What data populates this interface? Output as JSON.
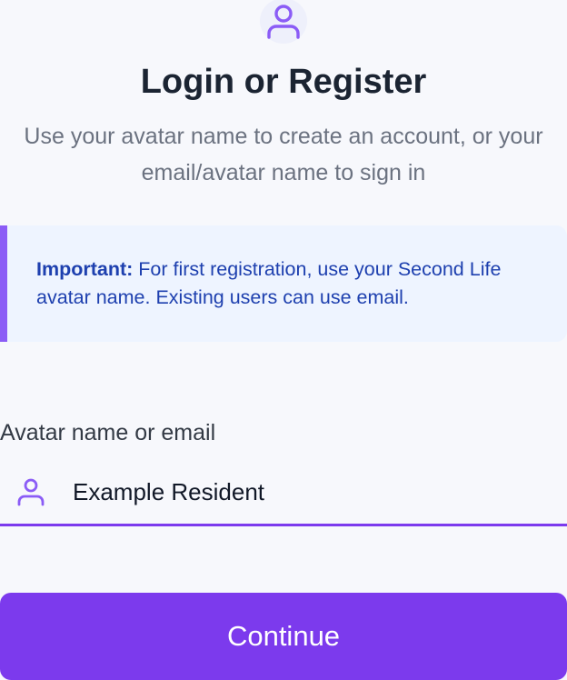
{
  "header": {
    "icon": "user-icon",
    "title": "Login or Register",
    "subtitle": "Use your avatar name to create an account, or your email/avatar name to sign in"
  },
  "notice": {
    "label": "Important:",
    "text": " For first registration, use your Second Life avatar name. Existing users can use email."
  },
  "form": {
    "field_label": "Avatar name or email",
    "field_icon": "user-icon",
    "field_value": "Example Resident",
    "submit_label": "Continue"
  },
  "colors": {
    "accent": "#7c3aed",
    "notice_bg": "#eef4ff",
    "notice_text": "#1e40af",
    "title": "#1b2432",
    "subtitle": "#6b7280"
  }
}
